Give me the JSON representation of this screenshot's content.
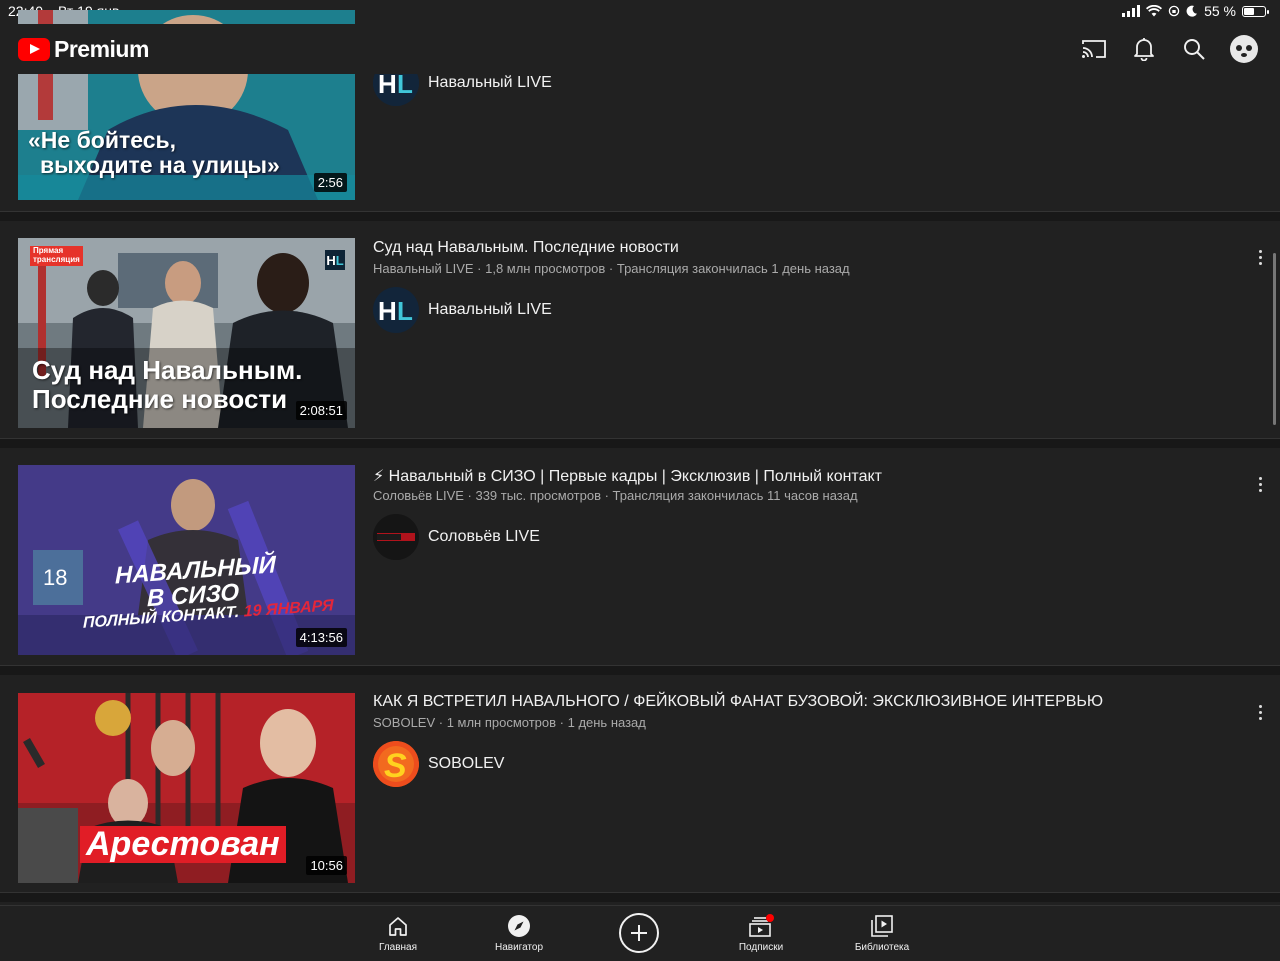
{
  "status_bar": {
    "time": "22:40",
    "date": "Вт 19 янв.",
    "battery": "55 %",
    "battery_level": 0.55
  },
  "header": {
    "logo_text": "Premium",
    "icons": [
      "cast-icon",
      "bell-icon",
      "search-icon",
      "avatar"
    ]
  },
  "videos": [
    {
      "thumb_text": [
        "«Не бойтесь,",
        "выходите на улицы»"
      ],
      "duration": "2:56",
      "channel": "Навальный LIVE"
    },
    {
      "title": "Суд над Навальным. Последние новости",
      "meta": "Навальный LIVE · 1,8 млн просмотров · Трансляция закончилась 1 день назад",
      "channel": "Навальный LIVE",
      "duration": "2:08:51",
      "thumb_badge": [
        "Прямая",
        "трансляция"
      ],
      "thumb_text": [
        "Суд над Навальным.",
        "Последние новости"
      ]
    },
    {
      "title": "⚡ Навальный в СИЗО | Первые кадры | Эксклюзив | Полный контакт",
      "meta": "Соловьёв LIVE · 339 тыс. просмотров · Трансляция закончилась 11 часов назад",
      "channel": "Соловьёв LIVE",
      "duration": "4:13:56",
      "thumb_text": [
        "НАВАЛЬНЫЙ",
        "В СИЗО",
        "ПОЛНЫЙ КОНТАКТ.",
        "19 ЯНВАРЯ"
      ]
    },
    {
      "title": "КАК Я ВСТРЕТИЛ НАВАЛЬНОГО / ФЕЙКОВЫЙ ФАНАТ БУЗОВОЙ: ЭКСКЛЮЗИВНОЕ ИНТЕРВЬЮ",
      "meta": "SOBOLEV · 1 млн просмотров · 1 день назад",
      "channel": "SOBOLEV",
      "duration": "10:56",
      "thumb_text": [
        "Арестован"
      ]
    }
  ],
  "bottom_nav": [
    {
      "label": "Главная",
      "icon": "home-icon"
    },
    {
      "label": "Навигатор",
      "icon": "compass-icon"
    },
    {
      "label": "",
      "icon": "create-icon"
    },
    {
      "label": "Подписки",
      "icon": "subscriptions-icon"
    },
    {
      "label": "Библиотека",
      "icon": "library-icon"
    }
  ],
  "colors": {
    "background": "#212121",
    "brand_red": "#ff0000",
    "meta_text": "#aaaaaa"
  }
}
